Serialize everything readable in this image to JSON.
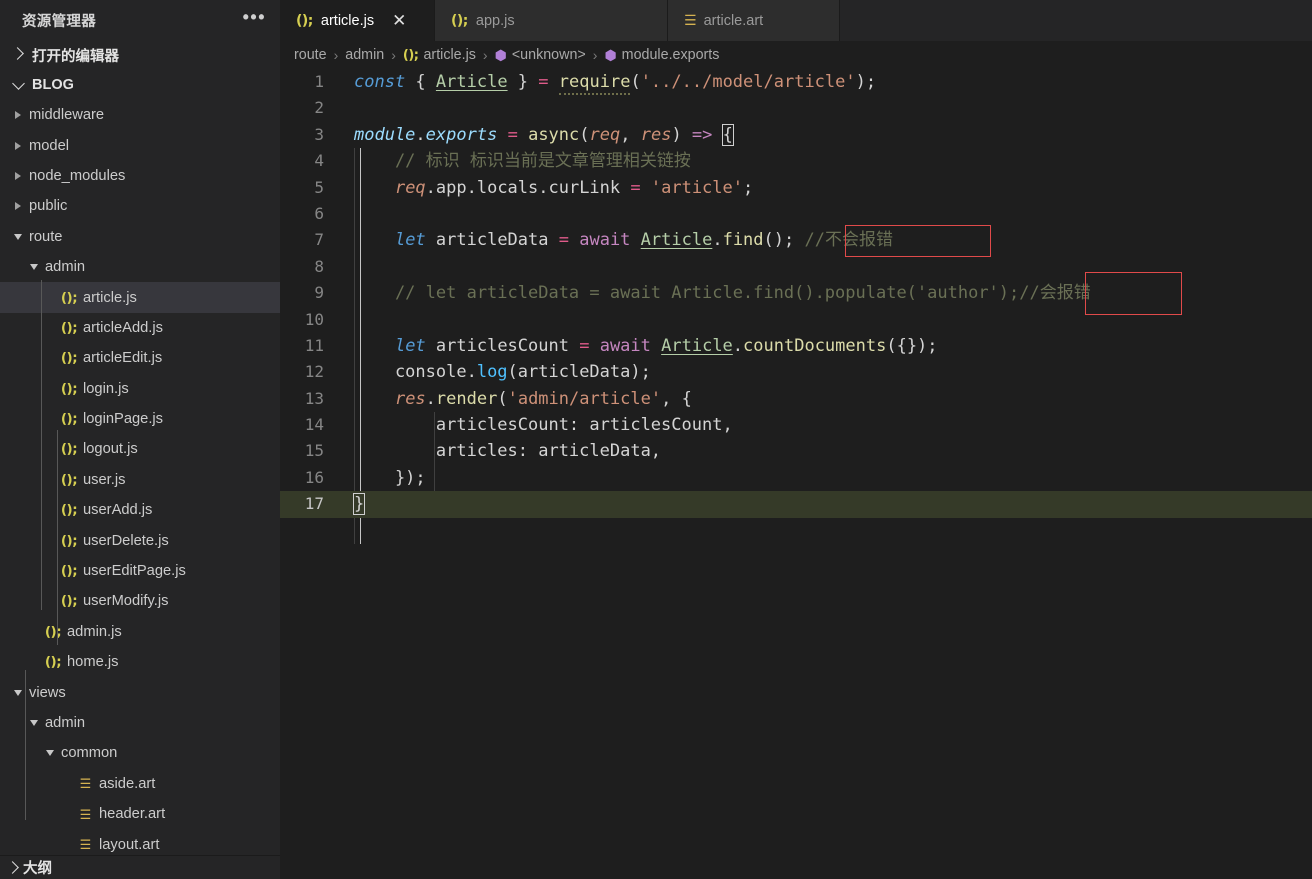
{
  "sidebar": {
    "title": "资源管理器",
    "more_icon": "ellipsis-icon",
    "open_editors": {
      "label": "打开的编辑器",
      "expanded": false
    },
    "workspace": {
      "label": "BLOG",
      "expanded": true
    },
    "outline": {
      "label": "大纲",
      "expanded": false
    },
    "items": [
      {
        "label": "middleware",
        "type": "folder",
        "depth": 1,
        "expanded": false
      },
      {
        "label": "model",
        "type": "folder",
        "depth": 1,
        "expanded": false
      },
      {
        "label": "node_modules",
        "type": "folder",
        "depth": 1,
        "expanded": false
      },
      {
        "label": "public",
        "type": "folder",
        "depth": 1,
        "expanded": false
      },
      {
        "label": "route",
        "type": "folder",
        "depth": 1,
        "expanded": true
      },
      {
        "label": "admin",
        "type": "folder",
        "depth": 2,
        "expanded": true
      },
      {
        "label": "article.js",
        "type": "js",
        "depth": 3,
        "selected": true
      },
      {
        "label": "articleAdd.js",
        "type": "js",
        "depth": 3
      },
      {
        "label": "articleEdit.js",
        "type": "js",
        "depth": 3
      },
      {
        "label": "login.js",
        "type": "js",
        "depth": 3
      },
      {
        "label": "loginPage.js",
        "type": "js",
        "depth": 3
      },
      {
        "label": "logout.js",
        "type": "js",
        "depth": 3
      },
      {
        "label": "user.js",
        "type": "js",
        "depth": 3
      },
      {
        "label": "userAdd.js",
        "type": "js",
        "depth": 3
      },
      {
        "label": "userDelete.js",
        "type": "js",
        "depth": 3
      },
      {
        "label": "userEditPage.js",
        "type": "js",
        "depth": 3
      },
      {
        "label": "userModify.js",
        "type": "js",
        "depth": 3
      },
      {
        "label": "admin.js",
        "type": "js",
        "depth": 2
      },
      {
        "label": "home.js",
        "type": "js",
        "depth": 2
      },
      {
        "label": "views",
        "type": "folder",
        "depth": 1,
        "expanded": true
      },
      {
        "label": "admin",
        "type": "folder",
        "depth": 2,
        "expanded": true
      },
      {
        "label": "common",
        "type": "folder",
        "depth": 3,
        "expanded": true
      },
      {
        "label": "aside.art",
        "type": "art",
        "depth": 4
      },
      {
        "label": "header.art",
        "type": "art",
        "depth": 4
      },
      {
        "label": "layout.art",
        "type": "art",
        "depth": 4
      }
    ]
  },
  "tabs": [
    {
      "label": "article.js",
      "icon": "js-file-icon",
      "active": true,
      "closable": true,
      "close_icon": "close-icon"
    },
    {
      "label": "app.js",
      "icon": "js-file-icon",
      "active": false,
      "closable": false
    },
    {
      "label": "article.art",
      "icon": "art-file-icon",
      "active": false,
      "closable": false
    }
  ],
  "breadcrumb": [
    {
      "label": "route",
      "icon": null
    },
    {
      "label": "admin",
      "icon": null
    },
    {
      "label": "article.js",
      "icon": "js-file-icon"
    },
    {
      "label": "<unknown>",
      "icon": "symbol-cube-icon"
    },
    {
      "label": "module.exports",
      "icon": "symbol-cube-icon"
    }
  ],
  "editor": {
    "filename": "article.js",
    "current_line": 17,
    "line_numbers": [
      "1",
      "2",
      "3",
      "4",
      "5",
      "6",
      "7",
      "8",
      "9",
      "10",
      "11",
      "12",
      "13",
      "14",
      "15",
      "16",
      "17"
    ],
    "lines_text": [
      "const { Article } = require('../../model/article');",
      "",
      "module.exports = async(req, res) => {",
      "    // 标识 标识当前是文章管理相关链按",
      "    req.app.locals.curLink = 'article';",
      "",
      "    let articleData = await Article.find(); //不会报错",
      "",
      "    // let articleData = await Article.find().populate('author');//会报错",
      "",
      "    let articlesCount = await Article.countDocuments({});",
      "    console.log(articleData);",
      "    res.render('admin/article', {",
      "        articlesCount: articlesCount,",
      "        articles: articleData,",
      "    });",
      "}"
    ],
    "tokens": {
      "l1": [
        "const",
        "{",
        "Article",
        "}",
        "=",
        "require",
        "(",
        "'../../model/article'",
        ")",
        ";"
      ],
      "l3": [
        "module",
        ".",
        "exports",
        "=",
        "async",
        "(",
        "req",
        ",",
        "res",
        ")",
        "=>",
        "{"
      ],
      "l4_comment": "// 标识 标识当前是文章管理相关链按",
      "l5": [
        "req",
        ".app.locals.curLink",
        "=",
        "'article'",
        ";"
      ],
      "l7": [
        "let",
        "articleData",
        "=",
        "await",
        "Article",
        ".find()",
        ";"
      ],
      "l7_comment": "//不会报错",
      "l9_comment": "// let articleData = await Article.find().populate('author');",
      "l9_comment_tail": "//会报错",
      "l11": [
        "let",
        "articlesCount",
        "=",
        "await",
        "Article",
        ".countDocuments({})",
        ";"
      ],
      "l12": [
        "console",
        ".",
        "log",
        "(articleData);"
      ],
      "l13": [
        "res",
        ".",
        "render",
        "(",
        "'admin/article'",
        ", {"
      ],
      "l14": "articlesCount: articlesCount,",
      "l15": "articles: articleData,",
      "l16": "});",
      "l17": "}"
    },
    "annotations": [
      {
        "name": "annotation-box-no-error",
        "color": "#e04a4a",
        "target_text": "//不会报错"
      },
      {
        "name": "annotation-box-error",
        "color": "#e04a4a",
        "target_text": "//会报错"
      }
    ]
  },
  "colors": {
    "sidebar_bg": "#252526",
    "editor_bg": "#1e1e1e",
    "tab_active_bg": "#1e1e1e",
    "tab_inactive_bg": "#2d2d2d",
    "selection_bg": "#37373d",
    "current_line_bg": "#353a28",
    "annotation_red": "#e04a4a",
    "js_icon_yellow": "#d6cf51",
    "art_icon_yellow": "#d6b351"
  }
}
